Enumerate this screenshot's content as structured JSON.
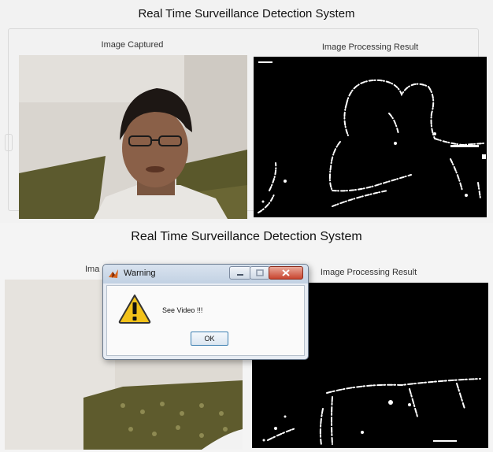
{
  "top_panel": {
    "title": "Real Time Surveillance Detection System",
    "captured_label": "Image Captured",
    "result_label": "Image Processing Result"
  },
  "bottom_panel": {
    "title": "Real Time Surveillance Detection System",
    "captured_label_partial": "Ima",
    "result_label": "Image Processing Result"
  },
  "warning_dialog": {
    "title": "Warning",
    "message": "See Video !!!",
    "ok_label": "OK"
  },
  "colors": {
    "dialog_close": "#c9452f",
    "binary_bg": "#000000",
    "edge": "#ffffff"
  },
  "icons": [
    "matlab-icon",
    "minimize-icon",
    "maximize-icon",
    "close-icon",
    "warning-icon"
  ]
}
